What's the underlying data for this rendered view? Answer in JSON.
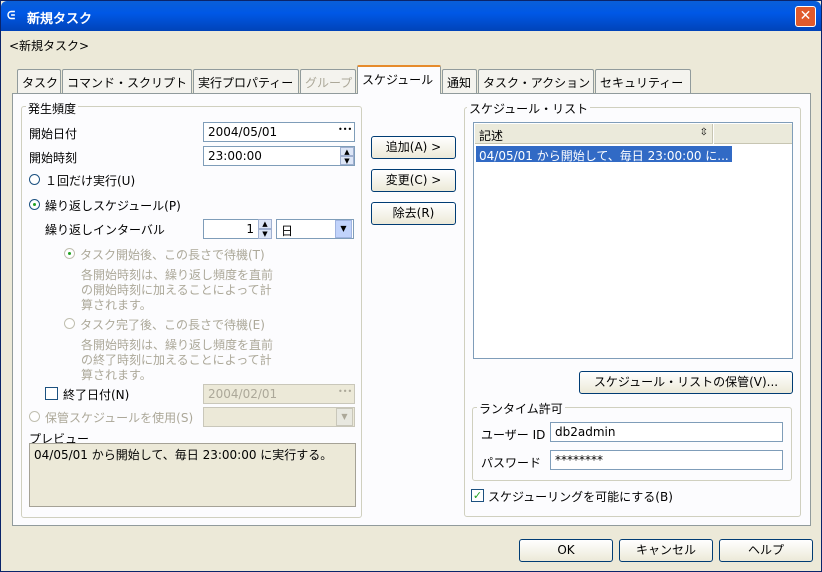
{
  "window": {
    "title": "新規タスク",
    "subtitle": "<新規タスク>",
    "close": "✕",
    "icon": "ᕮ"
  },
  "tabs": [
    "タスク",
    "コマンド・スクリプト",
    "実行プロパティー",
    "グループ",
    "スケジュール",
    "通知",
    "タスク・アクション",
    "セキュリティー"
  ],
  "frequency": {
    "group": "発生頻度",
    "start_date_label": "開始日付",
    "start_date": "2004/05/01",
    "start_time_label": "開始時刻",
    "start_time": "23:00:00",
    "once": "１回だけ実行(U)",
    "repeat": "繰り返しスケジュール(P)",
    "interval_label": "繰り返しインターバル",
    "interval_value": "1",
    "interval_unit": "日",
    "after_start": "タスク開始後、この長さで待機(T)",
    "after_start_desc": [
      "各開始時刻は、繰り返し頻度を直前",
      "の開始時刻に加えることによって計",
      "算されます。"
    ],
    "after_end": "タスク完了後、この長さで待機(E)",
    "after_end_desc": [
      "各開始時刻は、繰り返し頻度を直前",
      "の終了時刻に加えることによって計",
      "算されます。"
    ],
    "end_date_label": "終了日付(N)",
    "end_date": "2004/02/01",
    "saved_label": "保管スケジュールを使用(S)",
    "preview_label": "プレビュー",
    "preview": "04/05/01 から開始して、毎日 23:00:00 に実行する。",
    "ellipsis": "•••",
    "dd": "▼"
  },
  "actions": {
    "add": "追加(A) >",
    "change": "変更(C) >",
    "remove": "除去(R)"
  },
  "schedule_list": {
    "group": "スケジュール・リスト",
    "header": "記述",
    "sort": "⇳",
    "items": [
      "04/05/01 から開始して、毎日 23:00:00 に..."
    ],
    "save": "スケジュール・リストの保管(V)..."
  },
  "runtime": {
    "group": "ランタイム許可",
    "user_label": "ユーザー ID",
    "user": "db2admin",
    "password_label": "パスワード",
    "password": "********"
  },
  "enable_label": "スケジューリングを可能にする(B)",
  "footer": {
    "ok": "OK",
    "cancel": "キャンセル",
    "help": "ヘルプ"
  }
}
